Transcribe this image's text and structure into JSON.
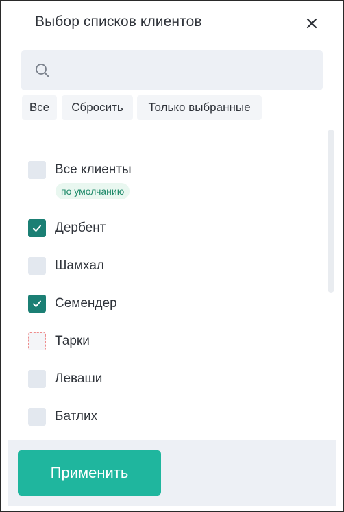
{
  "dialog": {
    "title": "Выбор списков клиентов",
    "close_icon": "close-icon"
  },
  "search": {
    "value": "",
    "placeholder": "",
    "icon": "search-icon"
  },
  "filters": {
    "all_label": "Все",
    "reset_label": "Сбросить",
    "selected_only_label": "Только выбранные"
  },
  "items": [
    {
      "label": "Все клиенты",
      "checked": false,
      "badge": "по умолчанию"
    },
    {
      "label": "Дербент",
      "checked": true
    },
    {
      "label": "Шамхал",
      "checked": false
    },
    {
      "label": "Семендер",
      "checked": true
    },
    {
      "label": "Тарки",
      "checked": false,
      "state": "highlighted"
    },
    {
      "label": "Леваши",
      "checked": false
    },
    {
      "label": "Батлих",
      "checked": false
    }
  ],
  "footer": {
    "apply_label": "Применить"
  },
  "colors": {
    "accent": "#1fb69e",
    "checkbox_checked": "#1b7f74",
    "checkbox_unchecked": "#e3e8ef",
    "badge_text": "#1f8a6a",
    "badge_bg": "#e9f7f0",
    "panel_bg": "#edf0f5"
  }
}
